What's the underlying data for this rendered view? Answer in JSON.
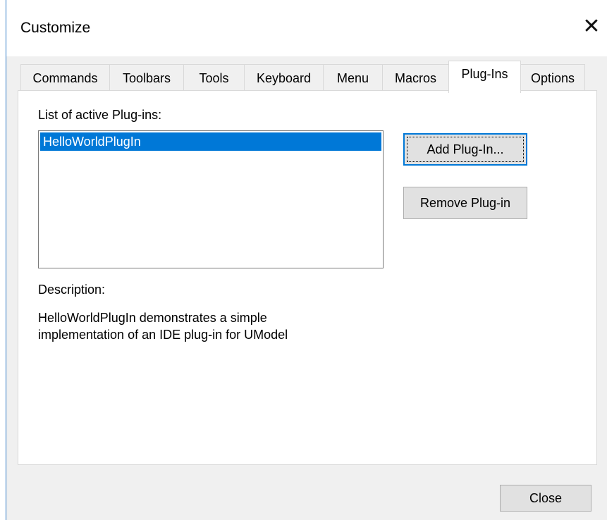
{
  "window": {
    "title": "Customize"
  },
  "tabs": [
    {
      "label": "Commands"
    },
    {
      "label": "Toolbars"
    },
    {
      "label": "Tools"
    },
    {
      "label": "Keyboard"
    },
    {
      "label": "Menu"
    },
    {
      "label": "Macros"
    },
    {
      "label": "Plug-Ins",
      "active": true
    },
    {
      "label": "Options"
    }
  ],
  "plugins": {
    "list_label": "List of active Plug-ins:",
    "items": [
      "HelloWorldPlugIn"
    ],
    "add_button": "Add Plug-In...",
    "remove_button": "Remove Plug-in",
    "description_label": "Description:",
    "description_lines": [
      "HelloWorldPlugIn demonstrates a simple",
      "implementation of an IDE plug-in for UModel"
    ]
  },
  "footer": {
    "close_button": "Close"
  },
  "colors": {
    "selection": "#0078d7",
    "dialog_bg": "#f0f0f0",
    "accent_border": "#2b78c6"
  },
  "icons": {
    "close": "close-icon"
  }
}
